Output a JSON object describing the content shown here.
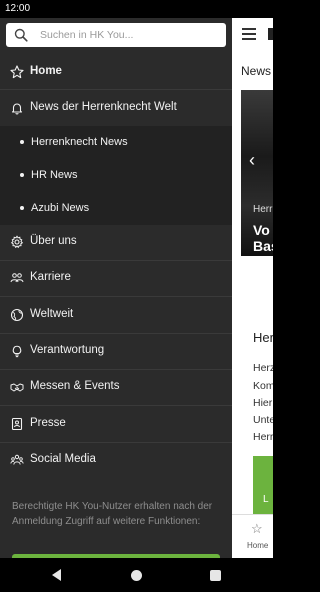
{
  "status_bar": {
    "time": "12:00"
  },
  "drawer": {
    "search": {
      "placeholder": "Suchen in HK You..."
    },
    "items": [
      {
        "label": "Home",
        "icon": "star-icon"
      },
      {
        "label": "News der Herrenknecht Welt",
        "icon": "bell-icon"
      },
      {
        "label": "Über uns",
        "icon": "gear-icon"
      },
      {
        "label": "Karriere",
        "icon": "people-icon"
      },
      {
        "label": "Weltweit",
        "icon": "globe-icon"
      },
      {
        "label": "Verantwortung",
        "icon": "lightbulb-icon"
      },
      {
        "label": "Messen & Events",
        "icon": "handshake-icon"
      },
      {
        "label": "Presse",
        "icon": "id-badge-icon"
      },
      {
        "label": "Social Media",
        "icon": "group-icon"
      }
    ],
    "sub_items": [
      {
        "label": "Herrenknecht News"
      },
      {
        "label": "HR News"
      },
      {
        "label": "Azubi News"
      }
    ],
    "note": "Berechtigte HK You-Nutzer erhalten nach der Anmeldung Zugriff auf weitere Funktionen:"
  },
  "background": {
    "news_title": "News",
    "hero_caption_small": "Herr",
    "hero_caption_line1": "Vo",
    "hero_caption_line2": "Bas",
    "section_title": "Her",
    "lines": [
      "Herz",
      "Kom",
      "Hier",
      "Unte",
      "Herr"
    ],
    "green_text": "L",
    "bottom_nav_label": "Home"
  },
  "colors": {
    "drawer_bg": "#2b2b2b",
    "submenu_bg": "#222222",
    "accent_green": "#6cb33e"
  }
}
